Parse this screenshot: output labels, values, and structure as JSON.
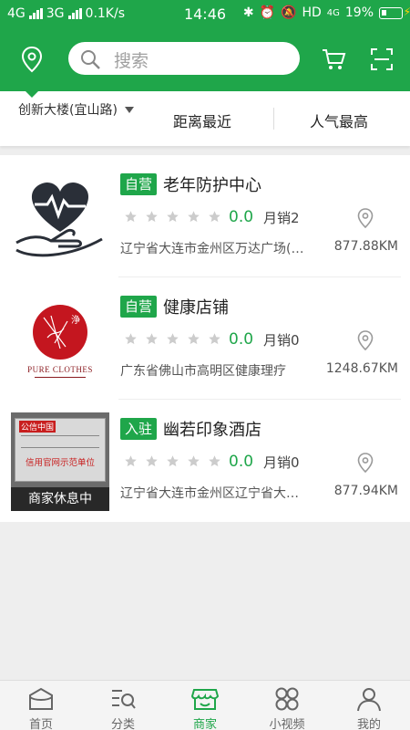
{
  "status_bar": {
    "network_left": "4G",
    "network_left2": "3G",
    "speed": "0.1K/s",
    "time": "14:46",
    "hd": "HD",
    "net4g": "4G",
    "battery": "19%"
  },
  "header": {
    "search_placeholder": "搜索",
    "icons": [
      "location-icon",
      "search-icon",
      "cart-icon",
      "scan-icon"
    ]
  },
  "filters": {
    "location": "创新大楼(宜山路)",
    "nearest": "距离最近",
    "popular": "人气最高"
  },
  "shops": [
    {
      "tag": "自营",
      "name": "老年防护中心",
      "rating": "0.0",
      "sales": "月销2",
      "address": "辽宁省大连市金州区万达广场(…",
      "distance": "877.88KM"
    },
    {
      "tag": "自营",
      "name": "健康店铺",
      "rating": "0.0",
      "sales": "月销0",
      "address": "广东省佛山市高明区健康理疗",
      "distance": "1248.67KM",
      "logo_text": "PURE CLOTHES",
      "logo_char": "浄"
    },
    {
      "tag": "入驻",
      "name": "幽若印象酒店",
      "rating": "0.0",
      "sales": "月销0",
      "address": "辽宁省大连市金州区辽宁省大…",
      "distance": "877.94KM",
      "status": "商家休息中",
      "cert_brand": "公信中国",
      "cert_title": "信用官网示范单位"
    }
  ],
  "nav": [
    {
      "label": "首页",
      "icon": "home-icon",
      "active": false
    },
    {
      "label": "分类",
      "icon": "category-icon",
      "active": false
    },
    {
      "label": "商家",
      "icon": "store-icon",
      "active": true
    },
    {
      "label": "小视频",
      "icon": "video-icon",
      "active": false
    },
    {
      "label": "我的",
      "icon": "profile-icon",
      "active": false
    }
  ],
  "colors": {
    "brand_green": "#1fa64a",
    "star_gray": "#cccccc"
  }
}
